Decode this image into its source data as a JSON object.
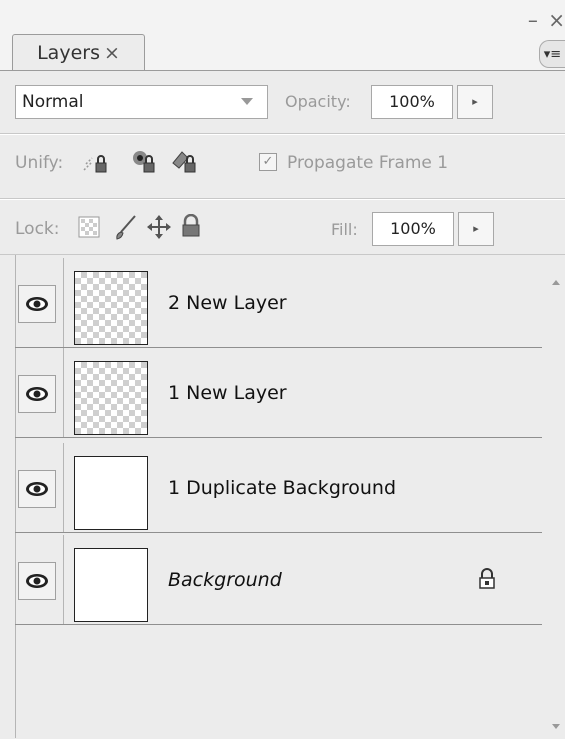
{
  "panel": {
    "tab_label": "Layers",
    "tab_close": "×"
  },
  "blend_mode": {
    "value": "Normal"
  },
  "opacity": {
    "label": "Opacity:",
    "value": "100%"
  },
  "unify": {
    "label": "Unify:",
    "propagate_label": "Propagate Frame 1",
    "propagate_checked": true
  },
  "lock": {
    "label": "Lock:"
  },
  "fill": {
    "label": "Fill:",
    "value": "100%"
  },
  "layers": [
    {
      "name": "2 New Layer",
      "visible": true,
      "transparent": true,
      "italic": false,
      "locked": false
    },
    {
      "name": "1 New Layer",
      "visible": true,
      "transparent": true,
      "italic": false,
      "locked": false
    },
    {
      "name": "1 Duplicate Background",
      "visible": true,
      "transparent": false,
      "italic": false,
      "locked": false
    },
    {
      "name": "Background",
      "visible": true,
      "transparent": false,
      "italic": true,
      "locked": true
    }
  ]
}
